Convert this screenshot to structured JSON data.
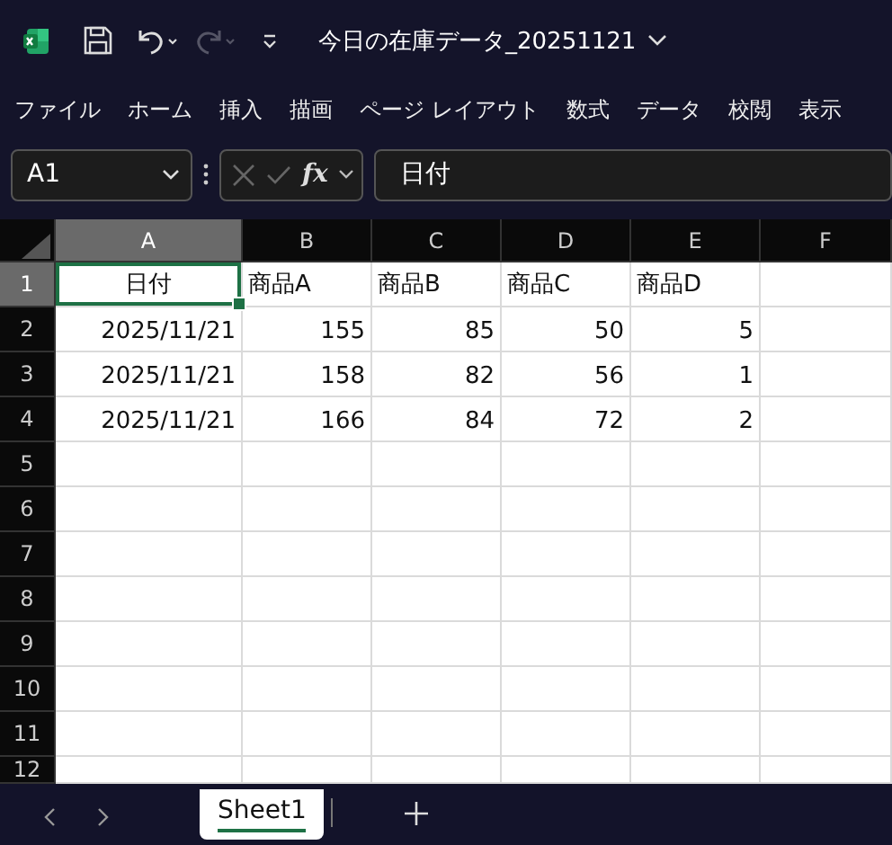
{
  "title_bar": {
    "title": "今日の在庫データ_20251121",
    "redo_disabled": true
  },
  "ribbon_tabs": [
    "ファイル",
    "ホーム",
    "挿入",
    "描画",
    "ページ レイアウト",
    "数式",
    "データ",
    "校閲",
    "表示"
  ],
  "formula_bar": {
    "name_box": "A1",
    "function_label": "fx",
    "value": "日付"
  },
  "columns": [
    {
      "label": "A",
      "selected": true
    },
    {
      "label": "B",
      "selected": false
    },
    {
      "label": "C",
      "selected": false
    },
    {
      "label": "D",
      "selected": false
    },
    {
      "label": "E",
      "selected": false
    },
    {
      "label": "F",
      "selected": false
    }
  ],
  "rows": [
    {
      "number": "1",
      "selected": true,
      "cells": [
        {
          "text": "日付",
          "kind": "centered"
        },
        {
          "text": "商品A",
          "kind": "text"
        },
        {
          "text": "商品B",
          "kind": "text"
        },
        {
          "text": "商品C",
          "kind": "text"
        },
        {
          "text": "商品D",
          "kind": "text"
        }
      ]
    },
    {
      "number": "2",
      "selected": false,
      "cells": [
        {
          "text": "2025/11/21",
          "kind": "number"
        },
        {
          "text": "155",
          "kind": "number"
        },
        {
          "text": "85",
          "kind": "number"
        },
        {
          "text": "50",
          "kind": "number"
        },
        {
          "text": "5",
          "kind": "number"
        }
      ]
    },
    {
      "number": "3",
      "selected": false,
      "cells": [
        {
          "text": "2025/11/21",
          "kind": "number"
        },
        {
          "text": "158",
          "kind": "number"
        },
        {
          "text": "82",
          "kind": "number"
        },
        {
          "text": "56",
          "kind": "number"
        },
        {
          "text": "1",
          "kind": "number"
        }
      ]
    },
    {
      "number": "4",
      "selected": false,
      "cells": [
        {
          "text": "2025/11/21",
          "kind": "number"
        },
        {
          "text": "166",
          "kind": "number"
        },
        {
          "text": "84",
          "kind": "number"
        },
        {
          "text": "72",
          "kind": "number"
        },
        {
          "text": "2",
          "kind": "number"
        }
      ]
    },
    {
      "number": "5",
      "selected": false,
      "cells": []
    },
    {
      "number": "6",
      "selected": false,
      "cells": []
    },
    {
      "number": "7",
      "selected": false,
      "cells": []
    },
    {
      "number": "8",
      "selected": false,
      "cells": []
    },
    {
      "number": "9",
      "selected": false,
      "cells": []
    },
    {
      "number": "10",
      "selected": false,
      "cells": []
    },
    {
      "number": "11",
      "selected": false,
      "cells": []
    },
    {
      "number": "12",
      "selected": false,
      "cells": []
    }
  ],
  "sheet_tabs": [
    {
      "label": "Sheet1",
      "selected": true
    }
  ]
}
